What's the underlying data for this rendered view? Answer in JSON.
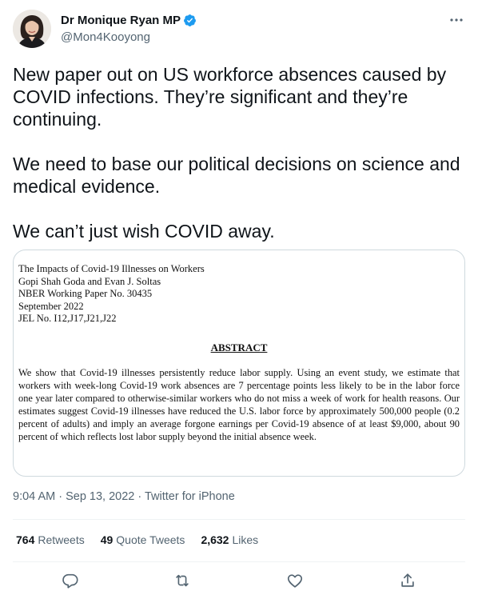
{
  "author": {
    "name": "Dr Monique Ryan MP",
    "handle": "@Mon4Kooyong",
    "verified": true
  },
  "tweet": {
    "paragraphs": [
      "New paper out on US workforce absences caused by COVID infections. They’re significant and they’re continuing.",
      "We need to base our political decisions on science and medical evidence.",
      "We can’t just wish COVID away."
    ]
  },
  "paper": {
    "meta_lines": [
      "The Impacts of Covid-19 Illnesses on Workers",
      "Gopi Shah Goda and Evan J. Soltas",
      "NBER Working Paper No. 30435",
      "September 2022",
      "JEL No. I12,J17,J21,J22"
    ],
    "abstract_title": "ABSTRACT",
    "abstract_text": "We show that Covid-19 illnesses persistently reduce labor supply. Using an event study, we estimate that workers with week-long Covid-19 work absences are 7 percentage points less likely to be in the labor force one year later compared to otherwise-similar workers who do not miss a week of work for health reasons. Our estimates suggest Covid-19 illnesses have reduced the U.S. labor force by approximately 500,000 people (0.2 percent of adults) and imply an average forgone earnings per Covid-19 absence of at least $9,000, about 90 percent of which reflects lost labor supply beyond the initial absence week."
  },
  "timestamp": "9:04 AM · Sep 13, 2022 · Twitter for iPhone",
  "stats": {
    "retweets": {
      "count": "764",
      "label": "Retweets"
    },
    "quote_tweets": {
      "count": "49",
      "label": "Quote Tweets"
    },
    "likes": {
      "count": "2,632",
      "label": "Likes"
    }
  },
  "icons": {
    "more": "more-icon",
    "verified": "verified-badge-icon",
    "reply": "reply-icon",
    "retweet": "retweet-icon",
    "like": "like-icon",
    "share": "share-icon"
  },
  "colors": {
    "verified_blue": "#1d9bf0",
    "secondary_text": "#536471",
    "border": "#cfd9de"
  }
}
